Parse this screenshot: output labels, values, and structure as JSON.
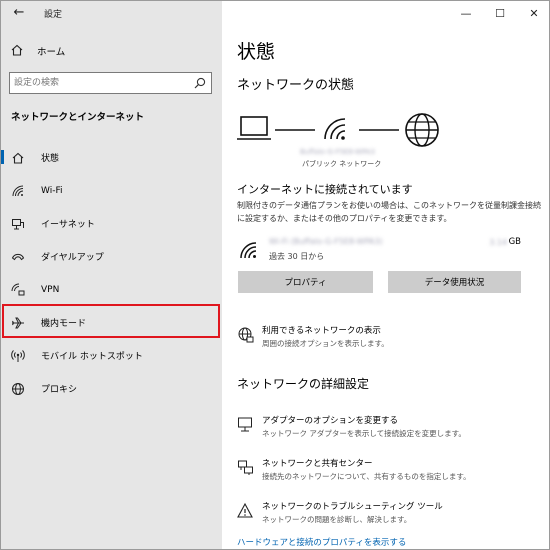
{
  "window": {
    "title": "設定",
    "back_glyph": "←",
    "controls": {
      "minimize": "—",
      "maximize": "☐",
      "close": "✕"
    }
  },
  "sidebar": {
    "home_label": "ホーム",
    "search_placeholder": "設定の検索",
    "section_title": "ネットワークとインターネット",
    "items": [
      {
        "label": "状態",
        "icon": "home-status-icon",
        "active": true
      },
      {
        "label": "Wi-Fi",
        "icon": "wifi-icon"
      },
      {
        "label": "イーサネット",
        "icon": "ethernet-icon"
      },
      {
        "label": "ダイヤルアップ",
        "icon": "dialup-icon"
      },
      {
        "label": "VPN",
        "icon": "vpn-icon"
      },
      {
        "label": "機内モード",
        "icon": "airplane-icon",
        "highlighted": true
      },
      {
        "label": "モバイル ホットスポット",
        "icon": "hotspot-icon"
      },
      {
        "label": "プロキシ",
        "icon": "globe-icon"
      }
    ]
  },
  "main": {
    "title": "状態",
    "network_status_heading": "ネットワークの状態",
    "network_name_blurred": "Buffalo-G-F5E8-WPA3",
    "network_category": "パブリック ネットワーク",
    "connected_heading": "インターネットに接続されています",
    "connected_description": "制限付きのデータ通信プランをお使いの場合は、このネットワークを従量制課金接続に設定するか、またはその他のプロパティを変更できます。",
    "usage": {
      "name_blurred": "Wi-Fi (Buffalo-G-F5E8-WPA3)",
      "period": "過去 30 日から",
      "amount_blurred": "3.14",
      "unit": "GB"
    },
    "buttons": {
      "properties": "プロパティ",
      "data_usage": "データ使用状況"
    },
    "available_networks": {
      "title": "利用できるネットワークの表示",
      "subtitle": "周囲の接続オプションを表示します。"
    },
    "advanced_heading": "ネットワークの詳細設定",
    "advanced_items": [
      {
        "title": "アダプターのオプションを変更する",
        "subtitle": "ネットワーク アダプターを表示して接続設定を変更します。"
      },
      {
        "title": "ネットワークと共有センター",
        "subtitle": "接続先のネットワークについて、共有するものを指定します。"
      },
      {
        "title": "ネットワークのトラブルシューティング ツール",
        "subtitle": "ネットワークの問題を診断し、解決します。"
      }
    ],
    "hardware_link": "ハードウェアと接続のプロパティを表示する"
  }
}
